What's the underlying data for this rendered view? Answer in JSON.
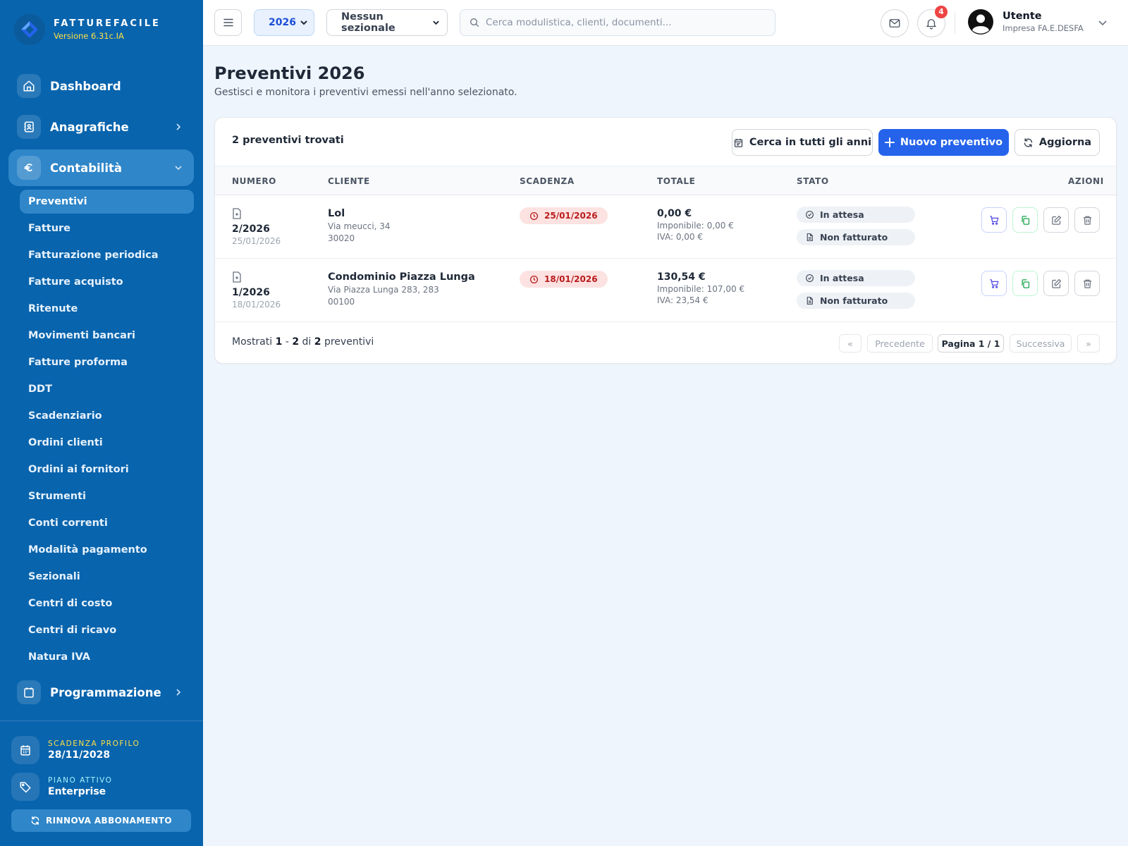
{
  "brand": {
    "name": "FATTUREFACILE",
    "version": "Versione 6.31c.IA"
  },
  "sidebar": {
    "main_items": [
      {
        "label": "Dashboard",
        "icon": "home-icon"
      },
      {
        "label": "Anagrafiche",
        "icon": "contacts-icon"
      },
      {
        "label": "Contabilità",
        "icon": "euro-icon",
        "expanded": true
      },
      {
        "label": "Programmazione",
        "icon": "calendar-icon"
      }
    ],
    "sub_items": [
      "Preventivi",
      "Fatture",
      "Fatturazione periodica",
      "Fatture acquisto",
      "Ritenute",
      "Movimenti bancari",
      "Fatture proforma",
      "DDT",
      "Scadenziario",
      "Ordini clienti",
      "Ordini ai fornitori",
      "Strumenti",
      "Conti correnti",
      "Modalità pagamento",
      "Sezionali",
      "Centri di costo",
      "Centri di ricavo",
      "Natura IVA"
    ],
    "active_sub_item": "Preventivi",
    "profile": {
      "expiry_label": "SCADENZA PROFILO",
      "expiry_value": "28/11/2028",
      "plan_label": "PIANO ATTIVO",
      "plan_value": "Enterprise"
    },
    "renew_label": "RINNOVA ABBONAMENTO"
  },
  "topbar": {
    "year": "2026",
    "sezionale": "Nessun sezionale",
    "search_placeholder": "Cerca modulistica, clienti, documenti...",
    "notifications_count": "4",
    "user_name": "Utente",
    "user_company": "Impresa FA.E.DESFA"
  },
  "page": {
    "title": "Preventivi 2026",
    "subtitle": "Gestisci e monitora i preventivi emessi nell'anno selezionato."
  },
  "card": {
    "count_text": "2 preventivi trovati",
    "btn_search_all": "Cerca in tutti gli anni",
    "btn_new": "Nuovo preventivo",
    "btn_refresh": "Aggiorna"
  },
  "table": {
    "headers": {
      "numero": "NUMERO",
      "cliente": "CLIENTE",
      "scadenza": "SCADENZA",
      "totale": "TOTALE",
      "stato": "STATO",
      "azioni": "AZIONI"
    },
    "rows": [
      {
        "numero": "2/2026",
        "data": "25/01/2026",
        "cliente": "Lol",
        "indirizzo": "Via meucci, 34",
        "cap": "30020",
        "scadenza": "25/01/2026",
        "totale": "0,00 €",
        "imponibile": "Imponibile: 0,00 €",
        "iva": "IVA: 0,00 €",
        "stato": "In attesa",
        "fatturazione": "Non fatturato"
      },
      {
        "numero": "1/2026",
        "data": "18/01/2026",
        "cliente": "Condominio Piazza Lunga",
        "indirizzo": "Via Piazza Lunga 283, 283",
        "cap": "00100",
        "scadenza": "18/01/2026",
        "totale": "130,54 €",
        "imponibile": "Imponibile: 107,00 €",
        "iva": "IVA: 23,54 €",
        "stato": "In attesa",
        "fatturazione": "Non fatturato"
      }
    ]
  },
  "pagination": {
    "shown_prefix": "Mostrati",
    "from": "1",
    "dash": "-",
    "to": "2",
    "of": "di",
    "total": "2",
    "suffix": "preventivi",
    "first": "«",
    "prev": "Precedente",
    "current": "Pagina 1 / 1",
    "next": "Successiva",
    "last": "»"
  },
  "colors": {
    "sidebar": "#0864ad",
    "primary": "#2563eb",
    "danger": "#ef4444",
    "due_bg": "#fde2e2",
    "due_text": "#b91c1c"
  }
}
